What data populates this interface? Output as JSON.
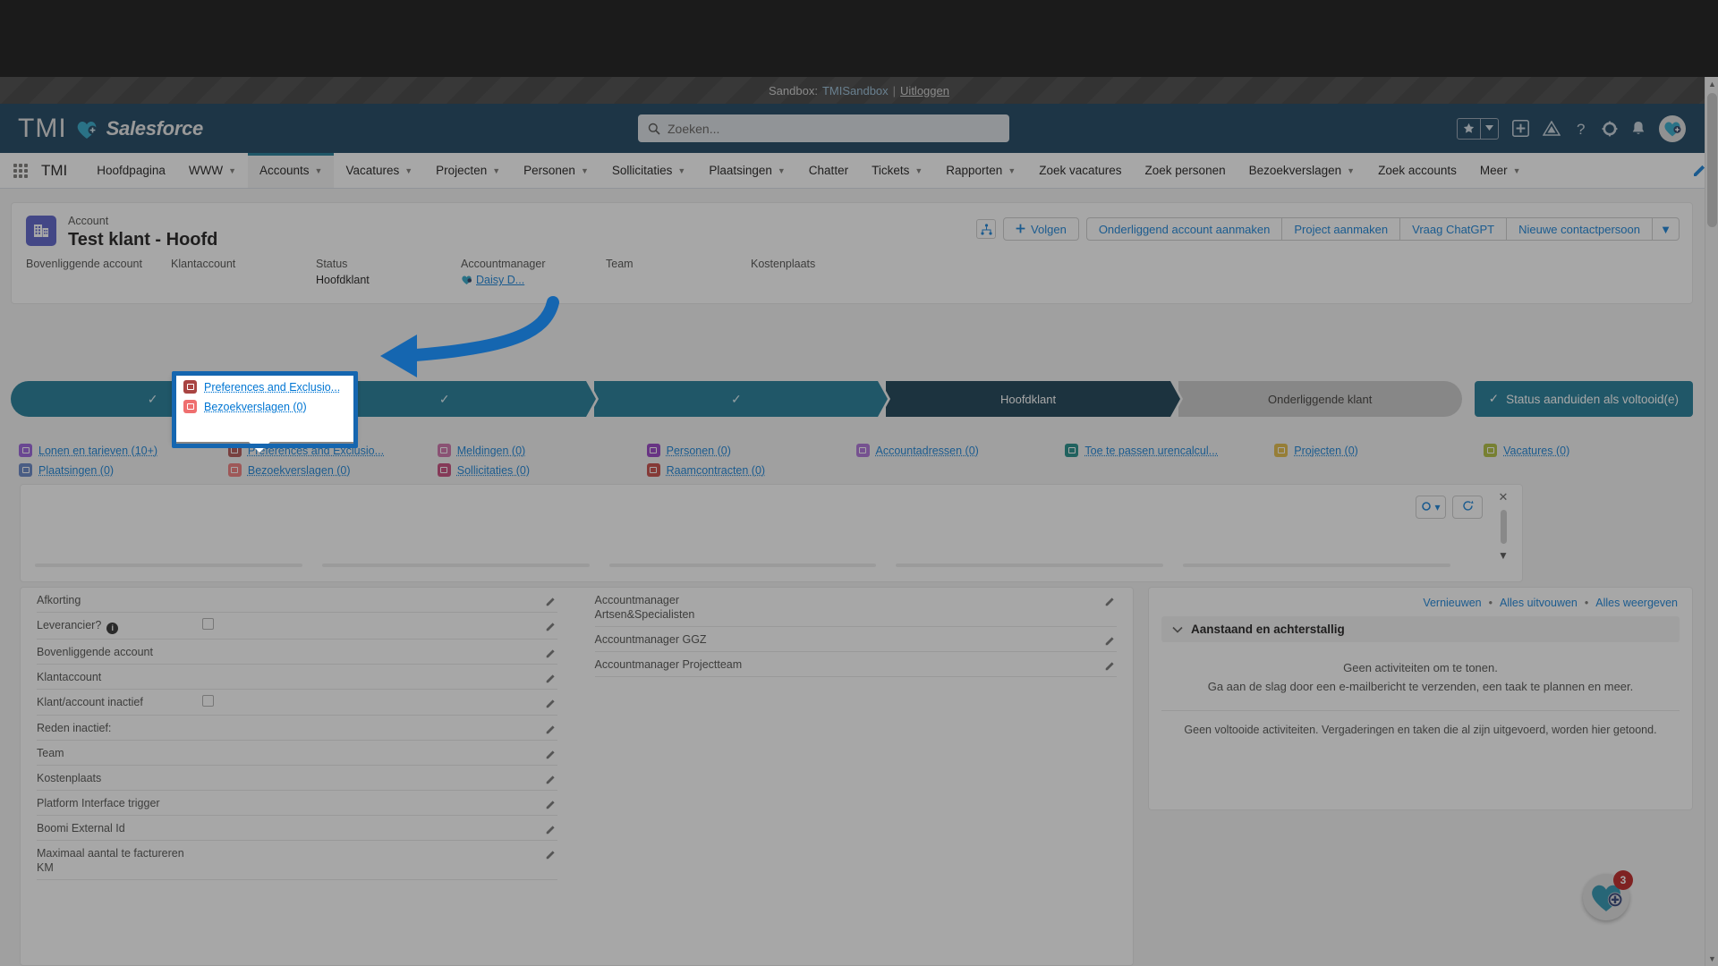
{
  "sandbox": {
    "prefix": "Sandbox: ",
    "name": "TMISandbox",
    "separator": " | ",
    "logout": "Uitloggen"
  },
  "header": {
    "brand_tmi": "TMI",
    "brand_product": "Salesforce",
    "search_placeholder": "Zoeken...",
    "icons": [
      "favorites-star-icon",
      "favorites-caret-icon",
      "add-icon",
      "trailhead-icon",
      "help-icon",
      "setup-gear-icon",
      "notifications-bell-icon",
      "user-avatar-icon"
    ]
  },
  "appnav": {
    "app_name": "TMI",
    "items": [
      {
        "label": "Hoofdpagina",
        "caret": false,
        "active": false
      },
      {
        "label": "WWW",
        "caret": true,
        "active": false
      },
      {
        "label": "Accounts",
        "caret": true,
        "active": true
      },
      {
        "label": "Vacatures",
        "caret": true,
        "active": false
      },
      {
        "label": "Projecten",
        "caret": true,
        "active": false
      },
      {
        "label": "Personen",
        "caret": true,
        "active": false
      },
      {
        "label": "Sollicitaties",
        "caret": true,
        "active": false
      },
      {
        "label": "Plaatsingen",
        "caret": true,
        "active": false
      },
      {
        "label": "Chatter",
        "caret": false,
        "active": false
      },
      {
        "label": "Tickets",
        "caret": true,
        "active": false
      },
      {
        "label": "Rapporten",
        "caret": true,
        "active": false
      },
      {
        "label": "Zoek vacatures",
        "caret": false,
        "active": false
      },
      {
        "label": "Zoek personen",
        "caret": false,
        "active": false
      },
      {
        "label": "Bezoekverslagen",
        "caret": true,
        "active": false
      },
      {
        "label": "Zoek accounts",
        "caret": false,
        "active": false
      },
      {
        "label": "Meer",
        "caret": true,
        "active": false
      }
    ]
  },
  "record": {
    "object_label": "Account",
    "title": "Test klant - Hoofd",
    "fields": [
      {
        "label": "Bovenliggende account",
        "value": ""
      },
      {
        "label": "Klantaccount",
        "value": ""
      },
      {
        "label": "Status",
        "value": "Hoofdklant"
      },
      {
        "label": "Accountmanager",
        "value": "Daisy D..."
      },
      {
        "label": "Team",
        "value": ""
      },
      {
        "label": "Kostenplaats",
        "value": ""
      }
    ],
    "actions": {
      "hierarchy": "account-hierarchy-icon",
      "follow": "Volgen",
      "buttons": [
        "Onderliggend account aanmaken",
        "Project aanmaken",
        "Vraag ChatGPT",
        "Nieuwe contactpersoon"
      ],
      "more_caret": "▼"
    }
  },
  "path": {
    "steps": [
      {
        "label": "",
        "state": "complete"
      },
      {
        "label": "",
        "state": "complete"
      },
      {
        "label": "",
        "state": "complete"
      },
      {
        "label": "Hoofdklant",
        "state": "current"
      },
      {
        "label": "Onderliggende klant",
        "state": "todo"
      }
    ],
    "complete_button": "Status aanduiden als voltooid(e)",
    "check_glyph": "✓"
  },
  "quick_links": [
    {
      "label": "Lonen en tarieven (10+)",
      "color": "#9050d9"
    },
    {
      "label": "Preferences and Exclusio...",
      "color": "#a94442"
    },
    {
      "label": "Meldingen (0)",
      "color": "#cb65a3"
    },
    {
      "label": "Personen (0)",
      "color": "#8c2fbf"
    },
    {
      "label": "Accountadressen (0)",
      "color": "#a764d6"
    },
    {
      "label": "Toe te passen urencalcul...",
      "color": "#0b827c"
    },
    {
      "label": "Projecten (0)",
      "color": "#e0b434"
    },
    {
      "label": "Vacatures (0)",
      "color": "#a8b82a"
    },
    {
      "label": "Plaatsingen (0)",
      "color": "#5679c0"
    },
    {
      "label": "Bezoekverslagen (0)",
      "color": "#ef6f6f"
    },
    {
      "label": "Sollicitaties (0)",
      "color": "#c23a6f"
    },
    {
      "label": "Raamcontracten (0)",
      "color": "#c23934"
    }
  ],
  "popover": {
    "items": [
      {
        "label": "Preferences and Exclusio...",
        "color": "#a94442"
      },
      {
        "label": "Bezoekverslagen (0)",
        "color": "#ef6f6f"
      }
    ]
  },
  "related_panel": {
    "settings_icon": "gear-icon",
    "settings_caret": "▾",
    "refresh_icon": "refresh-icon",
    "close_icon": "✕",
    "scroll_down_icon": "▼"
  },
  "detail": {
    "left_fields": [
      {
        "label": "Afkorting",
        "value": "",
        "type": "text"
      },
      {
        "label": "Leverancier?",
        "value": "",
        "type": "checkbox",
        "info": true
      },
      {
        "label": "Bovenliggende account",
        "value": "",
        "type": "text"
      },
      {
        "label": "Klantaccount",
        "value": "",
        "type": "text"
      },
      {
        "label": "Klant/account inactief",
        "value": "",
        "type": "checkbox"
      },
      {
        "label": "Reden inactief:",
        "value": "",
        "type": "text"
      },
      {
        "label": "Team",
        "value": "",
        "type": "text"
      },
      {
        "label": "Kostenplaats",
        "value": "",
        "type": "text"
      },
      {
        "label": "Platform Interface trigger",
        "value": "",
        "type": "text"
      },
      {
        "label": "Boomi External Id",
        "value": "",
        "type": "text"
      },
      {
        "label": "Maximaal aantal te factureren KM",
        "value": "",
        "type": "text"
      }
    ],
    "right_fields": [
      {
        "label": "Accountmanager Artsen&Specialisten",
        "value": "",
        "type": "text"
      },
      {
        "label": "Accountmanager GGZ",
        "value": "",
        "type": "text"
      },
      {
        "label": "Accountmanager Projectteam",
        "value": "",
        "type": "text"
      }
    ],
    "edit_icon": "pencil-icon"
  },
  "activity": {
    "links": [
      "Vernieuwen",
      "Alles uitvouwen",
      "Alles weergeven"
    ],
    "separator": "•",
    "section_title": "Aanstaand en achterstallig",
    "empty_line1": "Geen activiteiten om te tonen.",
    "empty_line2": "Ga aan de slag door een e-mailbericht te verzenden, een taak te plannen en meer.",
    "done_text": "Geen voltooide activiteiten. Vergaderingen en taken die al zijn uitgevoerd, worden hier getoond."
  },
  "fab": {
    "icon": "heart-plus-icon",
    "badge": "3"
  }
}
